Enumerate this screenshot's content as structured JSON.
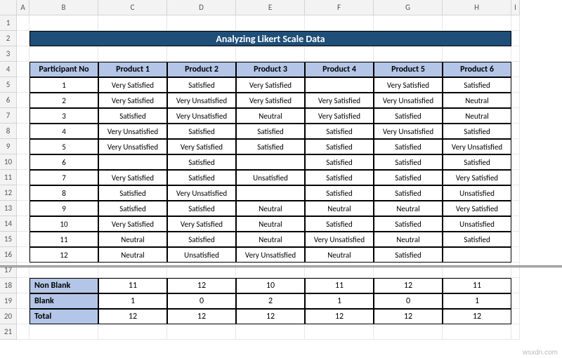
{
  "columns": [
    "",
    "A",
    "B",
    "C",
    "D",
    "E",
    "F",
    "G",
    "H",
    "I"
  ],
  "rows": [
    "1",
    "2",
    "3",
    "4",
    "5",
    "6",
    "7",
    "8",
    "9",
    "10",
    "11",
    "12",
    "13",
    "14",
    "15",
    "16",
    "17",
    "18",
    "19",
    "20",
    "21"
  ],
  "title": "Analyzing Likert Scale Data",
  "headers": [
    "Participant No",
    "Product 1",
    "Product 2",
    "Product 3",
    "Product 4",
    "Product 5",
    "Product 6"
  ],
  "data": [
    [
      "1",
      "Very Satisfied",
      "Satisfied",
      "Very Satisfied",
      "",
      "Very Satisfied",
      "Satisfied"
    ],
    [
      "2",
      "Very Satisfied",
      "Very Unsatisfied",
      "Very Satisfied",
      "Very Satisfied",
      "Very Unsatisfied",
      "Neutral"
    ],
    [
      "3",
      "Satisfied",
      "Very Unsatisfied",
      "Neutral",
      "Very Satisfied",
      "Satisfied",
      "Neutral"
    ],
    [
      "4",
      "Very Unsatisfied",
      "Satisfied",
      "Satisfied",
      "Satisfied",
      "Very Unsatisfied",
      "Satisfied"
    ],
    [
      "5",
      "Very Unsatisfied",
      "Very Satisfied",
      "Satisfied",
      "Satisfied",
      "Satisfied",
      "Very Unsatisfied"
    ],
    [
      "6",
      "",
      "Satisfied",
      "",
      "Satisfied",
      "Satisfied",
      "Satisfied"
    ],
    [
      "7",
      "Very Satisfied",
      "Satisfied",
      "Unsatisfied",
      "Satisfied",
      "Satisfied",
      "Very Satisfied"
    ],
    [
      "8",
      "Satisfied",
      "Very Unsatisfied",
      "",
      "Satisfied",
      "Satisfied",
      "Unsatisfied"
    ],
    [
      "9",
      "Satisfied",
      "Satisfied",
      "Neutral",
      "Neutral",
      "Neutral",
      "Very Satisfied"
    ],
    [
      "10",
      "Very Satisfied",
      "Very Satisfied",
      "Neutral",
      "Satisfied",
      "Satisfied",
      "Unsatisfied"
    ],
    [
      "11",
      "Neutral",
      "Satisfied",
      "Neutral",
      "Very Unsatisfied",
      "Neutral",
      "Satisfied"
    ],
    [
      "12",
      "Neutral",
      "Unsatisfied",
      "Very Unsatisfied",
      "Neutral",
      "Satisfied",
      ""
    ]
  ],
  "summary": [
    {
      "label": "Non Blank",
      "vals": [
        "11",
        "12",
        "10",
        "11",
        "12",
        "11"
      ]
    },
    {
      "label": "Blank",
      "vals": [
        "1",
        "0",
        "2",
        "1",
        "0",
        "1"
      ]
    },
    {
      "label": "Total",
      "vals": [
        "12",
        "12",
        "12",
        "12",
        "12",
        "12"
      ]
    }
  ],
  "watermark": "wsxdn.com"
}
